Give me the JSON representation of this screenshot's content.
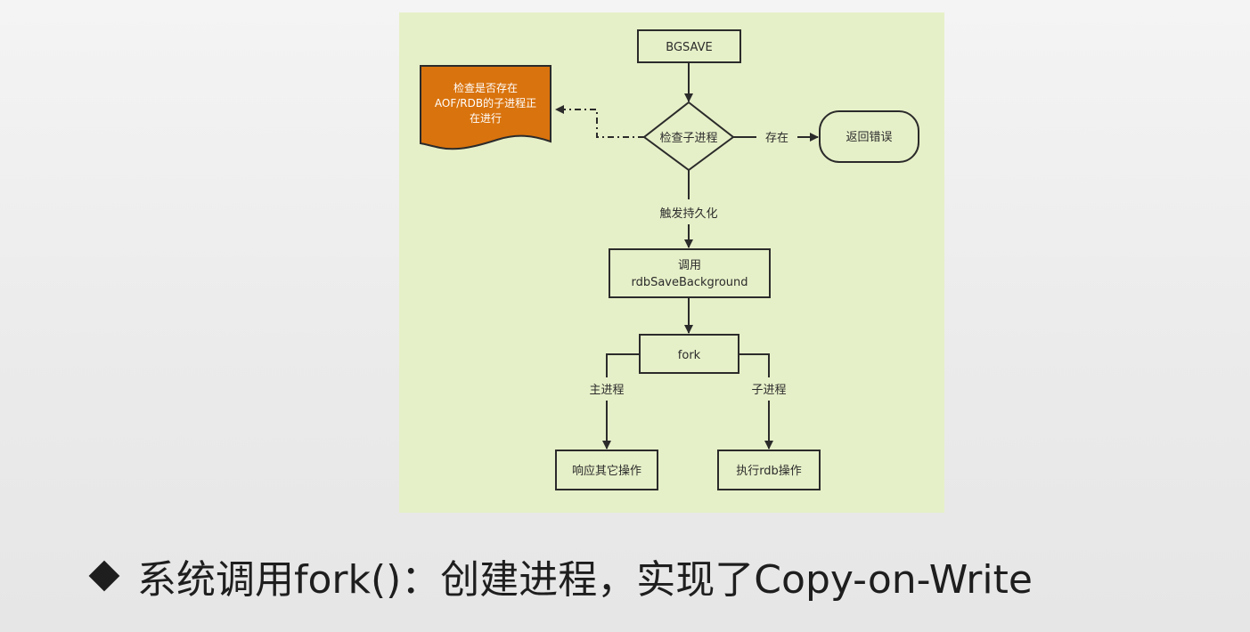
{
  "diagram": {
    "nodes": {
      "bgsave": "BGSAVE",
      "check_child": "检查子进程",
      "return_error": "返回错误",
      "call_line1": "调用",
      "call_line2": "rdbSaveBackground",
      "fork": "fork",
      "respond": "响应其它操作",
      "exec_rdb": "执行rdb操作"
    },
    "note": {
      "line1": "检查是否存在",
      "line2": "AOF/RDB的子进程正",
      "line3": "在进行"
    },
    "edges": {
      "exists": "存在",
      "trigger": "触发持久化",
      "main_process": "主进程",
      "child_process": "子进程"
    }
  },
  "caption": {
    "text": "系统调用fork()：创建进程，实现了Copy-on-Write"
  },
  "colors": {
    "panel_bg": "#e6f0c8",
    "note_fill": "#d9730d",
    "stroke": "#2b2b2b"
  }
}
